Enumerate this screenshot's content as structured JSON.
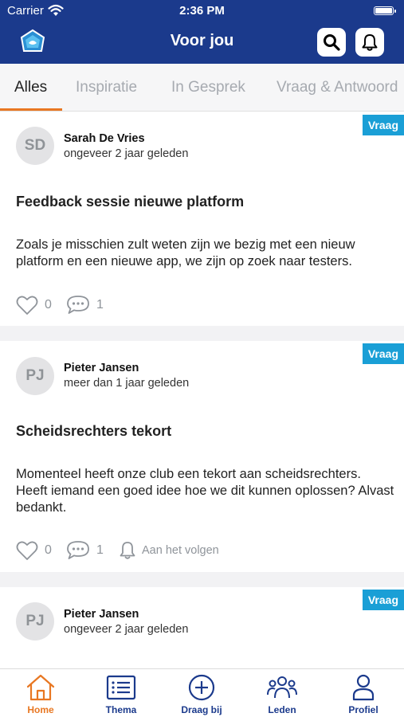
{
  "status_bar": {
    "carrier": "Carrier",
    "time": "2:36 PM"
  },
  "header": {
    "title": "Voor jou"
  },
  "tabs": [
    {
      "label": "Alles",
      "active": true
    },
    {
      "label": "Inspiratie",
      "active": false
    },
    {
      "label": "In Gesprek",
      "active": false
    },
    {
      "label": "Vraag & Antwoord",
      "active": false
    }
  ],
  "posts": [
    {
      "badge": "Vraag",
      "initials": "SD",
      "author": "Sarah De Vries",
      "time": "ongeveer 2 jaar geleden",
      "title": "Feedback sessie nieuwe platform",
      "body": "Zoals je misschien zult weten zijn we bezig met een nieuw platform en een nieuwe app, we zijn op zoek naar testers.",
      "likes": "0",
      "comments": "1"
    },
    {
      "badge": "Vraag",
      "initials": "PJ",
      "author": "Pieter Jansen",
      "time": "meer dan 1 jaar geleden",
      "title": "Scheidsrechters tekort",
      "body": "Momenteel heeft onze club een tekort aan scheidsrechters. Heeft iemand een goed idee hoe we dit kunnen oplossen? Alvast bedankt.",
      "likes": "0",
      "comments": "1",
      "follow": "Aan het volgen"
    },
    {
      "badge": "Vraag",
      "initials": "PJ",
      "author": "Pieter Jansen",
      "time": "ongeveer 2 jaar geleden"
    }
  ],
  "bottom_nav": [
    {
      "label": "Home",
      "icon": "home-icon",
      "active": true
    },
    {
      "label": "Thema",
      "icon": "list-icon",
      "active": false
    },
    {
      "label": "Draag bij",
      "icon": "plus-circle-icon",
      "active": false
    },
    {
      "label": "Leden",
      "icon": "members-icon",
      "active": false
    },
    {
      "label": "Profiel",
      "icon": "profile-icon",
      "active": false
    }
  ],
  "colors": {
    "brand_blue": "#1b3a8c",
    "accent_orange": "#e87722",
    "badge_blue": "#1a9fd6"
  }
}
